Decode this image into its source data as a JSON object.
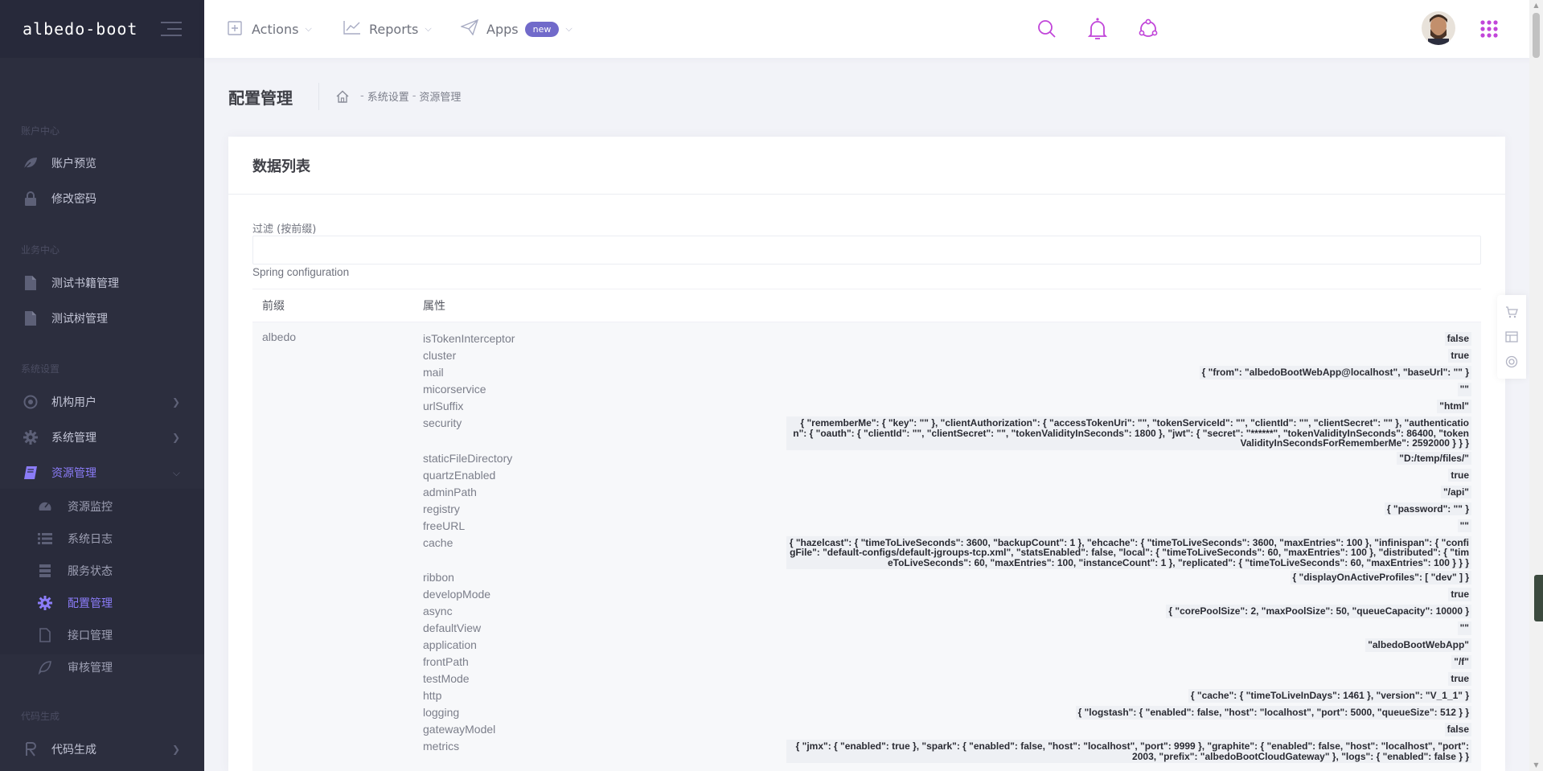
{
  "brand": {
    "name": "albedo-boot"
  },
  "sidebar": {
    "sections": [
      {
        "label": "账户中心"
      },
      {
        "label": "业务中心"
      },
      {
        "label": "系统设置"
      },
      {
        "label": "代码生成"
      }
    ],
    "items": [
      {
        "label": "账户预览",
        "icon": "leaf-icon"
      },
      {
        "label": "修改密码",
        "icon": "lock-icon"
      },
      {
        "label": "测试书籍管理",
        "icon": "file-icon"
      },
      {
        "label": "测试树管理",
        "icon": "file-icon"
      },
      {
        "label": "机构用户",
        "icon": "target-icon"
      },
      {
        "label": "系统管理",
        "icon": "gear-icon"
      },
      {
        "label": "资源管理",
        "icon": "book-icon"
      },
      {
        "label": "代码生成",
        "icon": "code-icon"
      }
    ],
    "subitems": [
      {
        "label": "资源监控",
        "icon": "monitor-icon"
      },
      {
        "label": "系统日志",
        "icon": "list-icon"
      },
      {
        "label": "服务状态",
        "icon": "server-icon"
      },
      {
        "label": "配置管理",
        "icon": "gear-icon"
      },
      {
        "label": "接口管理",
        "icon": "doc-icon"
      },
      {
        "label": "审核管理",
        "icon": "leaf-icon"
      }
    ]
  },
  "topbar": {
    "menus": [
      {
        "label": "Actions",
        "icon": "plus-square-icon"
      },
      {
        "label": "Reports",
        "icon": "chart-icon"
      },
      {
        "label": "Apps",
        "icon": "paper-plane-icon",
        "badge": "new"
      }
    ],
    "icons": [
      "search-icon",
      "bell-icon",
      "share-icon",
      "apps-grid-icon"
    ],
    "accent": "#c145d9"
  },
  "page": {
    "title": "配置管理",
    "breadcrumb": [
      "系统设置",
      "资源管理"
    ]
  },
  "portlet": {
    "title": "数据列表",
    "filter_label": "过滤 (按前缀)",
    "filter_value": "",
    "section_caption": "Spring configuration",
    "columns": [
      "前缀",
      "属性"
    ],
    "prefix": "albedo",
    "properties": [
      {
        "name": "isTokenInterceptor",
        "value": "false"
      },
      {
        "name": "cluster",
        "value": "true"
      },
      {
        "name": "mail",
        "value": "{ \"from\": \"albedoBootWebApp@localhost\", \"baseUrl\": \"\" }"
      },
      {
        "name": "micorservice",
        "value": "\"\""
      },
      {
        "name": "urlSuffix",
        "value": "\"html\""
      },
      {
        "name": "security",
        "value": "{ \"rememberMe\": { \"key\": \"\" }, \"clientAuthorization\": { \"accessTokenUri\": \"\", \"tokenServiceId\": \"\", \"clientId\": \"\", \"clientSecret\": \"\" }, \"authentication\": { \"oauth\": { \"clientId\": \"\", \"clientSecret\": \"\", \"tokenValidityInSeconds\": 1800 }, \"jwt\": { \"secret\": \"******\", \"tokenValidityInSeconds\": 86400, \"tokenValidityInSecondsForRememberMe\": 2592000 } } }"
      },
      {
        "name": "staticFileDirectory",
        "value": "\"D:/temp/files/\""
      },
      {
        "name": "quartzEnabled",
        "value": "true"
      },
      {
        "name": "adminPath",
        "value": "\"/api\""
      },
      {
        "name": "registry",
        "value": "{ \"password\": \"\" }"
      },
      {
        "name": "freeURL",
        "value": "\"\""
      },
      {
        "name": "cache",
        "value": "{ \"hazelcast\": { \"timeToLiveSeconds\": 3600, \"backupCount\": 1 }, \"ehcache\": { \"timeToLiveSeconds\": 3600, \"maxEntries\": 100 }, \"infinispan\": { \"configFile\": \"default-configs/default-jgroups-tcp.xml\", \"statsEnabled\": false, \"local\": { \"timeToLiveSeconds\": 60, \"maxEntries\": 100 }, \"distributed\": { \"timeToLiveSeconds\": 60, \"maxEntries\": 100, \"instanceCount\": 1 }, \"replicated\": { \"timeToLiveSeconds\": 60, \"maxEntries\": 100 } } }"
      },
      {
        "name": "ribbon",
        "value": "{ \"displayOnActiveProfiles\": [ \"dev\" ] }"
      },
      {
        "name": "developMode",
        "value": "true"
      },
      {
        "name": "async",
        "value": "{ \"corePoolSize\": 2, \"maxPoolSize\": 50, \"queueCapacity\": 10000 }"
      },
      {
        "name": "defaultView",
        "value": "\"\""
      },
      {
        "name": "application",
        "value": "\"albedoBootWebApp\""
      },
      {
        "name": "frontPath",
        "value": "\"/f\""
      },
      {
        "name": "testMode",
        "value": "true"
      },
      {
        "name": "http",
        "value": "{ \"cache\": { \"timeToLiveInDays\": 1461 }, \"version\": \"V_1_1\" }"
      },
      {
        "name": "logging",
        "value": "{ \"logstash\": { \"enabled\": false, \"host\": \"localhost\", \"port\": 5000, \"queueSize\": 512 } }"
      },
      {
        "name": "gatewayModel",
        "value": "false"
      },
      {
        "name": "metrics",
        "value": "{ \"jmx\": { \"enabled\": true }, \"spark\": { \"enabled\": false, \"host\": \"localhost\", \"port\": 9999 }, \"graphite\": { \"enabled\": false, \"host\": \"localhost\", \"port\": 2003, \"prefix\": \"albedoBootCloudGateway\" }, \"logs\": { \"enabled\": false } }"
      }
    ]
  },
  "quick_toolbar": {
    "icons": [
      "cart-icon",
      "layout-icon",
      "lifebuoy-icon"
    ]
  },
  "colors": {
    "sidebar_bg": "#2c2e3e",
    "active": "#8b7cf8",
    "badge": "#716aca"
  }
}
